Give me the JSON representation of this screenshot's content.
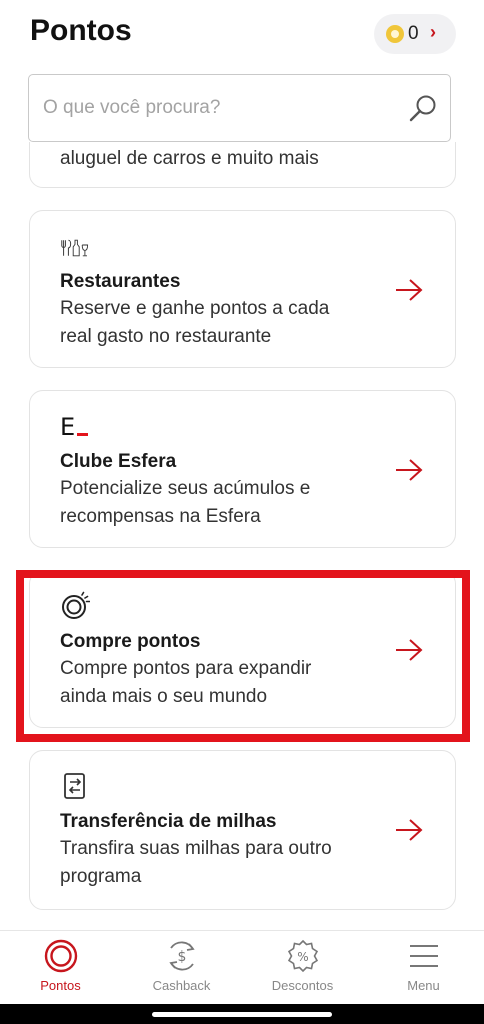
{
  "header": {
    "title": "Pontos",
    "points": "0",
    "points_chevron": "›"
  },
  "search": {
    "placeholder": "O que você procura?"
  },
  "cards": [
    {
      "title": "",
      "description": "aluguel de carros e muito mais",
      "icon": ""
    },
    {
      "title": "Restaurantes",
      "description": "Reserve e ganhe pontos a cada real gasto no restaurante",
      "icon": "cutlery-icon"
    },
    {
      "title": "Clube Esfera",
      "description": "Potencialize seus acúmulos e recompensas na Esfera",
      "icon": "esfera-logo",
      "icon_text": "E"
    },
    {
      "title": "Compre pontos",
      "description": "Compre pontos para expandir ainda mais o seu mundo",
      "icon": "coins-icon"
    },
    {
      "title": "Transferência de milhas",
      "description": "Transfira suas milhas para outro programa",
      "icon": "transfer-icon"
    }
  ],
  "tabs": [
    {
      "label": "Pontos",
      "icon": "pontos-icon",
      "active": true
    },
    {
      "label": "Cashback",
      "icon": "cashback-icon",
      "active": false
    },
    {
      "label": "Descontos",
      "icon": "discount-icon",
      "active": false
    },
    {
      "label": "Menu",
      "icon": "menu-icon",
      "active": false
    }
  ],
  "colors": {
    "accent": "#c7161d",
    "highlight": "#e3141c",
    "coin": "#f0c63a"
  }
}
